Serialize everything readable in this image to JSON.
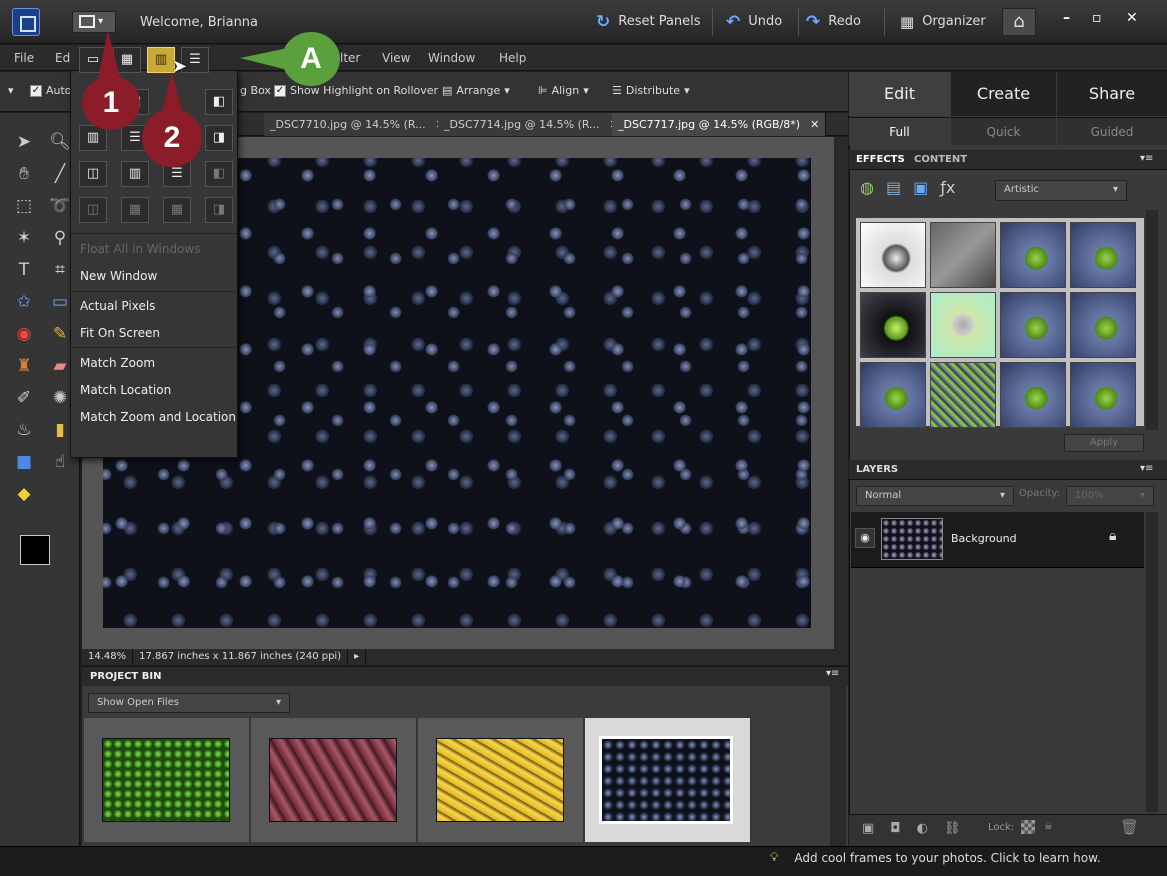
{
  "titlebar": {
    "welcome": "Welcome, Brianna",
    "buttons": [
      {
        "label": "Reset Panels",
        "icon": "reset-icon"
      },
      {
        "label": "Undo",
        "icon": "undo-icon"
      },
      {
        "label": "Redo",
        "icon": "redo-icon"
      },
      {
        "label": "Organizer",
        "icon": "organizer-icon"
      }
    ],
    "window_controls": [
      "–",
      "▫",
      "✕"
    ]
  },
  "menubar": {
    "items": [
      "File",
      "Ed",
      "lter",
      "View",
      "Window",
      "Help"
    ]
  },
  "options": {
    "auto_select": "Auto",
    "bounding_box": "g Box",
    "show_highlight": "Show Highlight on Rollover",
    "arrange": "Arrange",
    "align": "Align",
    "distribute": "Distribute"
  },
  "tabs": [
    {
      "label": "_DSC7710.jpg @ 14.5% (R...",
      "close": "✕"
    },
    {
      "label": "_DSC7714.jpg @ 14.5% (R...",
      "close": "✕"
    },
    {
      "label": "_DSC7717.jpg @ 14.5% (RGB/8*)",
      "close": "✕",
      "active": true
    }
  ],
  "status": {
    "zoom": "14.48%",
    "doc_size": "17.867 inches x 11.867 inches (240 ppi)"
  },
  "project_bin": {
    "title": "PROJECT BIN",
    "filter": "Show Open Files"
  },
  "right_panel": {
    "tabs": [
      "Edit",
      "Create",
      "Share"
    ],
    "subtabs": [
      "Full",
      "Quick",
      "Guided"
    ],
    "effects_tabs": [
      "EFFECTS",
      "CONTENT"
    ],
    "effects_filter": "Artistic",
    "apply": "Apply",
    "layers_title": "LAYERS",
    "blend_mode": "Normal",
    "opacity_label": "Opacity:",
    "opacity_value": "100%",
    "layer_name": "Background",
    "lock_label": "Lock:"
  },
  "layout_menu": {
    "items": [
      "Float All in Windows",
      "New Window",
      "Actual Pixels",
      "Fit On Screen",
      "Match Zoom",
      "Match Location",
      "Match Zoom and Location"
    ]
  },
  "callouts": {
    "one": "1",
    "two": "2",
    "a": "A"
  },
  "bottom": {
    "tip": "Add cool frames to your photos. Click to learn how."
  },
  "colors": {
    "accent_gold": "#c9a83a",
    "callout_red": "#8c1c28",
    "callout_green": "#5aa13d"
  }
}
